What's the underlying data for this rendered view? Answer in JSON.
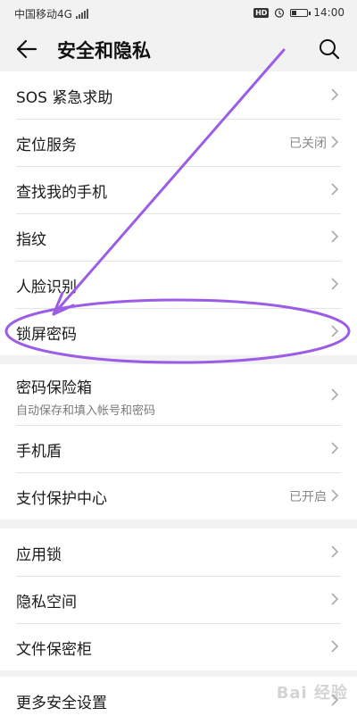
{
  "status_bar": {
    "carrier": "中国移动4G",
    "network": "4G",
    "hd": "HD",
    "time": "14:00"
  },
  "header": {
    "title": "安全和隐私",
    "back_icon": "back-arrow-icon",
    "search_icon": "search-icon"
  },
  "groups": [
    [
      {
        "label": "SOS 紧急求助"
      },
      {
        "label": "定位服务",
        "status": "已关闭"
      },
      {
        "label": "查找我的手机"
      },
      {
        "label": "指纹"
      },
      {
        "label": "人脸识别"
      },
      {
        "label": "锁屏密码"
      }
    ],
    [
      {
        "label": "密码保险箱",
        "subtitle": "自动保存和填入帐号和密码"
      },
      {
        "label": "手机盾"
      },
      {
        "label": "支付保护中心",
        "status": "已开启"
      }
    ],
    [
      {
        "label": "应用锁"
      },
      {
        "label": "隐私空间"
      },
      {
        "label": "文件保密柜"
      }
    ],
    [
      {
        "label": "更多安全设置"
      }
    ]
  ],
  "annotation": {
    "color": "#9b5de5"
  },
  "watermark": "Bai 经验"
}
